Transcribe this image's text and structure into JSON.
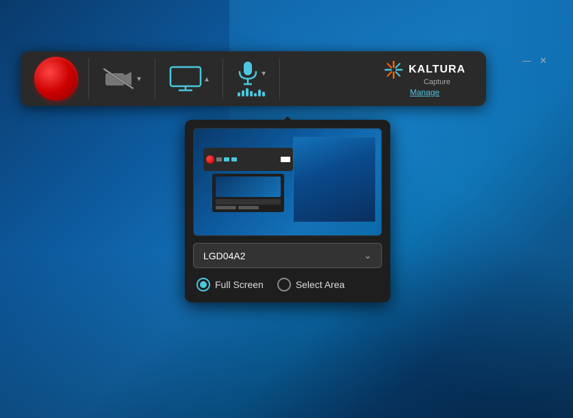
{
  "desktop": {
    "background": "windows-10-blue"
  },
  "window": {
    "min_label": "—",
    "close_label": "✕"
  },
  "toolbar": {
    "record_label": "Record",
    "camera_label": "Camera",
    "monitor_label": "Screen",
    "mic_label": "Microphone",
    "kaltura_name": "KALTURA",
    "kaltura_sub": "Capture",
    "manage_label": "Manage"
  },
  "dropdown": {
    "monitor_name": "LGD04A2",
    "select_chevron": "⌄",
    "options": [
      {
        "value": "LGD04A2",
        "label": "LGD04A2"
      }
    ],
    "capture_mode": {
      "full_screen": {
        "label": "Full Screen",
        "selected": true
      },
      "select_area": {
        "label": "Select Area",
        "selected": false
      }
    }
  }
}
